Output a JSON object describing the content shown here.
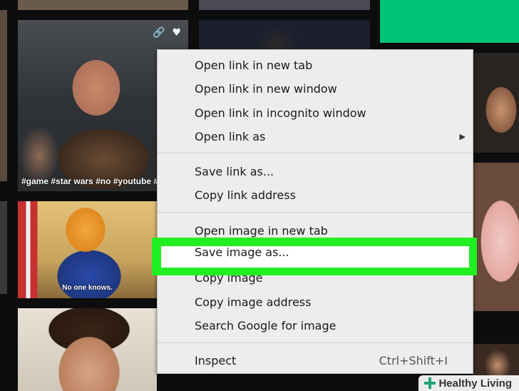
{
  "tiles": {
    "bald_caption": "#game #star wars #no #youtube #",
    "trump_caption": "No one knows.",
    "icons": [
      "link-icon",
      "heart-icon"
    ]
  },
  "context_menu": {
    "items": [
      {
        "label": "Open link in new tab"
      },
      {
        "label": "Open link in new window"
      },
      {
        "label": "Open link in incognito window"
      },
      {
        "label": "Open link as",
        "submenu": true,
        "arrow": "▶"
      },
      {
        "label": "Save link as..."
      },
      {
        "label": "Copy link address"
      },
      {
        "label": "Open image in new tab"
      },
      {
        "label": "Save image as...",
        "highlighted": true
      },
      {
        "label": "Copy image"
      },
      {
        "label": "Copy image address"
      },
      {
        "label": "Search Google for image"
      },
      {
        "label": "Inspect",
        "shortcut": "Ctrl+Shift+I"
      }
    ],
    "highlight_color": "#22ee22"
  },
  "watermark": {
    "text": "Healthy Living",
    "icon": "plus-cross-icon",
    "color": "#21a37a"
  }
}
